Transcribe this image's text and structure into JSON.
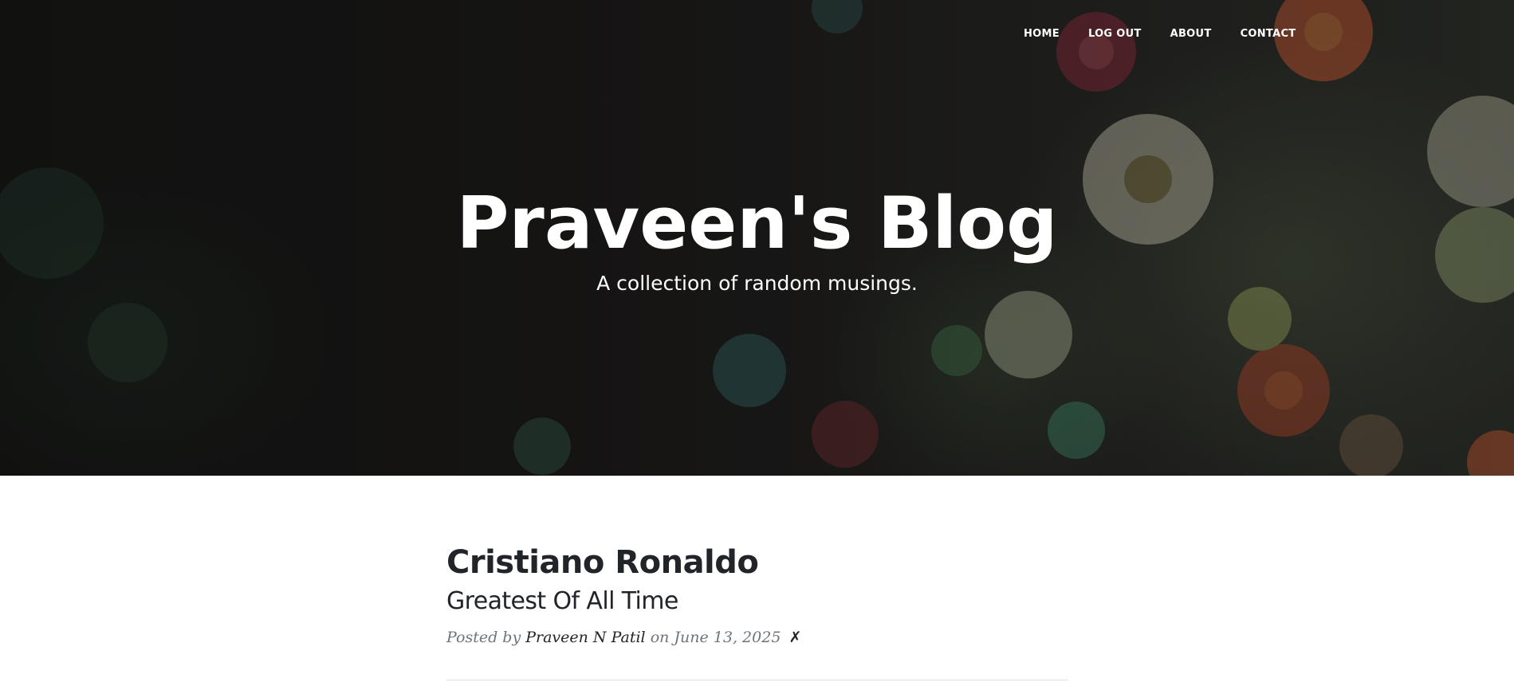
{
  "nav": {
    "home": "HOME",
    "logout": "LOG OUT",
    "about": "ABOUT",
    "contact": "CONTACT"
  },
  "header": {
    "title": "Praveen's Blog",
    "subtitle": "A collection of random musings."
  },
  "posts": [
    {
      "title": "Cristiano Ronaldo",
      "subtitle": "Greatest Of All Time",
      "posted_by_prefix": "Posted by",
      "author": "Praveen N Patil",
      "date_prefix": "on",
      "date": "June 13, 2025",
      "delete_glyph": "✗"
    }
  ],
  "colors": {
    "text_dark": "#212529",
    "text_muted": "#6c757d",
    "divider": "#dee2e6"
  }
}
